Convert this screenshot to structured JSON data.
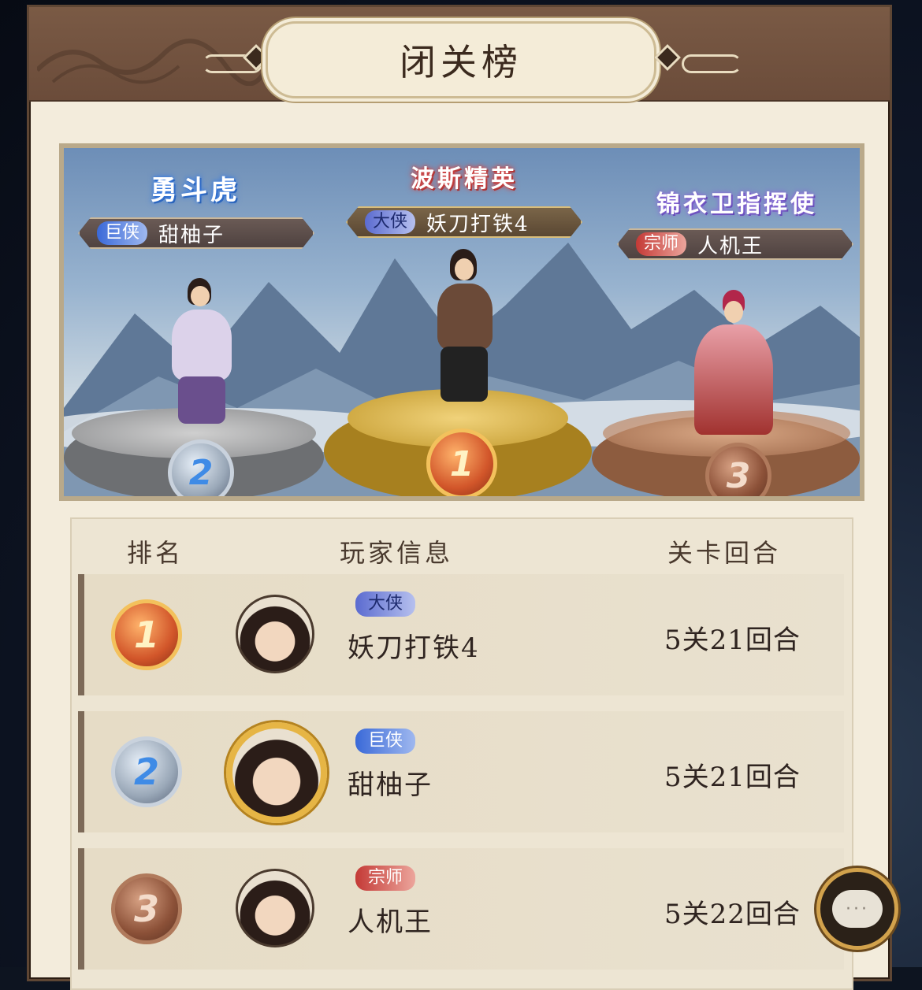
{
  "header": {
    "title": "闭关榜"
  },
  "podium": [
    {
      "rank": "2",
      "title_art": "勇斗虎",
      "badge": "巨侠",
      "name": "甜柚子"
    },
    {
      "rank": "1",
      "title_art": "波斯精英",
      "badge": "大侠",
      "name": "妖刀打铁4"
    },
    {
      "rank": "3",
      "title_art": "锦衣卫指挥使",
      "badge": "宗师",
      "name": "人机王"
    }
  ],
  "table": {
    "headers": {
      "rank": "排名",
      "player": "玩家信息",
      "score": "关卡回合"
    },
    "rows": [
      {
        "rank": "1",
        "badge": "大侠",
        "name": "妖刀打铁4",
        "score": "5关21回合"
      },
      {
        "rank": "2",
        "badge": "巨侠",
        "name": "甜柚子",
        "score": "5关21回合"
      },
      {
        "rank": "3",
        "badge": "宗师",
        "name": "人机王",
        "score": "5关22回合"
      }
    ]
  },
  "chat": {
    "icon": "chat-bubble-icon",
    "dots": "···"
  }
}
